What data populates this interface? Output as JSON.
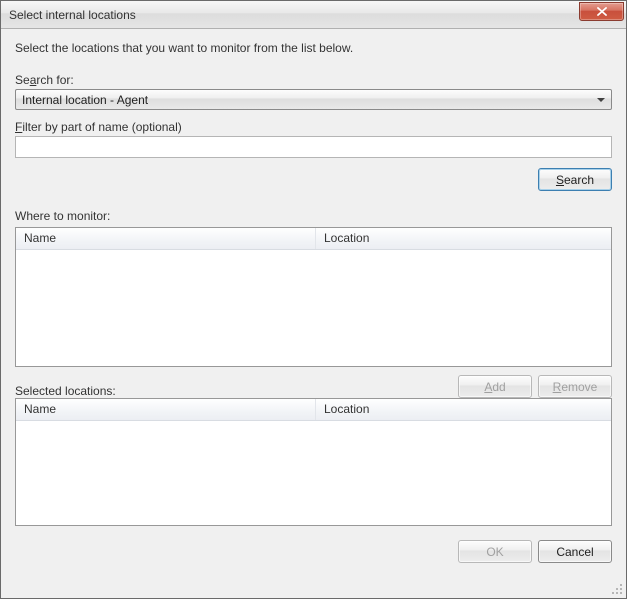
{
  "title": "Select internal locations",
  "intro": "Select the locations that you want to monitor from the list below.",
  "search": {
    "label_pre": "Se",
    "label_u": "a",
    "label_post": "rch for:",
    "selected": "Internal location - Agent",
    "filter_label_u": "F",
    "filter_label_post": "ilter by part of name (optional)",
    "filter_value": "",
    "button_u": "S",
    "button_post": "earch"
  },
  "where": {
    "label": "Where to monitor:",
    "columns": {
      "name": "Name",
      "location": "Location"
    },
    "rows": []
  },
  "actions": {
    "add_u": "A",
    "add_post": "dd",
    "remove_u": "R",
    "remove_post": "emove"
  },
  "selected": {
    "label": "Selected locations:",
    "columns": {
      "name": "Name",
      "location": "Location"
    },
    "rows": []
  },
  "footer": {
    "ok": "OK",
    "cancel": "Cancel"
  }
}
